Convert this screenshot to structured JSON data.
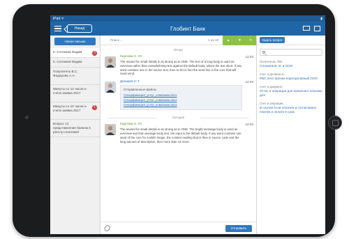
{
  "statusbar": {
    "left": "iPad ᯤ",
    "right": "▮"
  },
  "topbar": {
    "title": "Глобинт Банк",
    "back_label": "Назад"
  },
  "sidebar": {
    "new_button_label": "Новое письмо",
    "items": [
      {
        "label": "К. Сотников Вадим",
        "badge": "3"
      },
      {
        "label": "К. Сотников Вадим",
        "badge": ""
      },
      {
        "label": "Покупатель В.С. Федорова А.А.",
        "badge": ""
      },
      {
        "label": "Минуты со 12 часов и счета заявка 2017",
        "badge": ""
      },
      {
        "label": "Минуты со 12 часов и счета заявка 2017",
        "badge": "1"
      },
      {
        "label": "Вопрос 12 представление банком в реестр платежей",
        "badge": ""
      }
    ]
  },
  "chat": {
    "search_text": "Поиск ...",
    "count": "1 из 10",
    "day_today": "Вчера",
    "day_older": "Сегодня",
    "messages": [
      {
        "author": "Карпова Н. Ю.",
        "time": "12:03",
        "text": "The reward for small details is as strong as to ONE. The text of a long body is used as overview rather than overwhelming text against the default body, where the text short. If any word contains one in the source text, then to list or fact the word line in the core that will need send."
      },
      {
        "author": "Докирев Н.Т.",
        "time": "12:03",
        "files_title": "Отправленные файлы",
        "files": [
          "Спецификация_услуг_компании.docx",
          "Спецификация_услуг_компании.docx",
          "Спецификация_услуг_компании.docx"
        ]
      },
      {
        "author": "Карпова Н. Ю.",
        "time": "12:03",
        "text": "The reward for small details is as strong as to ONE. The bright message body is used as overview text than average body text, the input is the default body. If any word contains one word of the core for a while longer, the content reading that is then in source code and the long amount of description, then more than 14 more."
      }
    ],
    "compose_placeholder": "",
    "send_label": "Отправить"
  },
  "right": {
    "ask_label": "Задать вопрос",
    "search_placeholder": "",
    "info": [
      {
        "label": "Получатель ГВС",
        "value": "Сотников В. И. и ООО"
      },
      {
        "label": "Счет и должность",
        "value": "РБС ЗАО Хроник Корпоративный ООО"
      },
      {
        "label": "Счет и документ",
        "value": "Отчет и операции для наличного платежа для"
      },
      {
        "label": "Счет и операция",
        "value": "В случае если оплачен и согласовано платеж и оплате в срок"
      }
    ]
  },
  "colors": {
    "primary": "#1f66a8",
    "accent_green": "#8cc04b",
    "badge_red": "#d33b3b",
    "link_blue": "#2a6fb5"
  }
}
